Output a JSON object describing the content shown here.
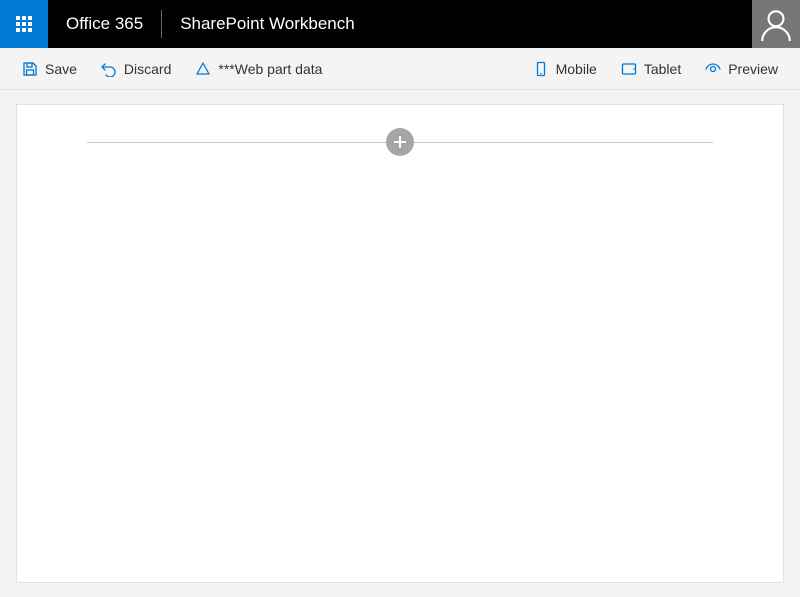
{
  "header": {
    "brand": "Office 365",
    "app_name": "SharePoint Workbench"
  },
  "commands": {
    "left": [
      {
        "id": "save",
        "label": "Save",
        "icon": "save-icon"
      },
      {
        "id": "discard",
        "label": "Discard",
        "icon": "undo-icon"
      },
      {
        "id": "webpart-data",
        "label": "***Web part data",
        "icon": "triangle-icon"
      }
    ],
    "right": [
      {
        "id": "mobile",
        "label": "Mobile",
        "icon": "phone-icon"
      },
      {
        "id": "tablet",
        "label": "Tablet",
        "icon": "tablet-icon"
      },
      {
        "id": "preview",
        "label": "Preview",
        "icon": "eye-icon"
      }
    ]
  },
  "canvas": {
    "add_button_title": "Add a new web part"
  },
  "colors": {
    "accent": "#0078d4",
    "header_bg": "#000000",
    "avatar_bg": "#777777"
  }
}
